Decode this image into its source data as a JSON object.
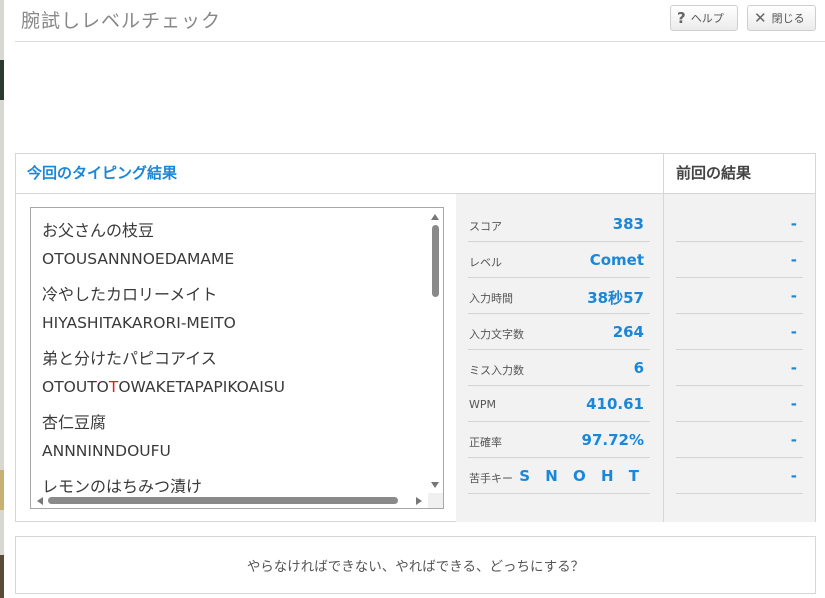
{
  "window": {
    "title": "腕試しレベルチェック"
  },
  "header": {
    "help_label": "ヘルプ",
    "close_label": "閉じる"
  },
  "current": {
    "title": "今回のタイピング結果",
    "entries": [
      {
        "jp": "お父さんの枝豆",
        "romaji": "OTOUSANNNOEDAMAME"
      },
      {
        "jp": "冷やしたカロリーメイト",
        "romaji": "HIYASHITAKARORI-MEITO"
      },
      {
        "jp": "弟と分けたパピコアイス",
        "romaji_before": "OTOUTO",
        "romaji_error": "T",
        "romaji_after": "OWAKETAPAPIKOAISU"
      },
      {
        "jp": "杏仁豆腐",
        "romaji": "ANNNINNDOUFU"
      },
      {
        "jp": "レモンのはちみつ漬け",
        "romaji": ""
      }
    ],
    "stats": [
      {
        "label": "スコア",
        "value": "383"
      },
      {
        "label": "レベル",
        "value": "Comet"
      },
      {
        "label": "入力時間",
        "value": "38秒57"
      },
      {
        "label": "入力文字数",
        "value": "264"
      },
      {
        "label": "ミス入力数",
        "value": "6"
      },
      {
        "label": "WPM",
        "value": "410.61"
      },
      {
        "label": "正確率",
        "value": "97.72%"
      },
      {
        "label": "苦手キー",
        "value": "S N O H T"
      }
    ]
  },
  "previous": {
    "title": "前回の結果",
    "values": [
      "-",
      "-",
      "-",
      "-",
      "-",
      "-",
      "-",
      "-"
    ]
  },
  "message": "やらなければできない、やればできる、どっちにする？",
  "colors": {
    "accent": "#1a87d8",
    "error": "#e02020"
  }
}
